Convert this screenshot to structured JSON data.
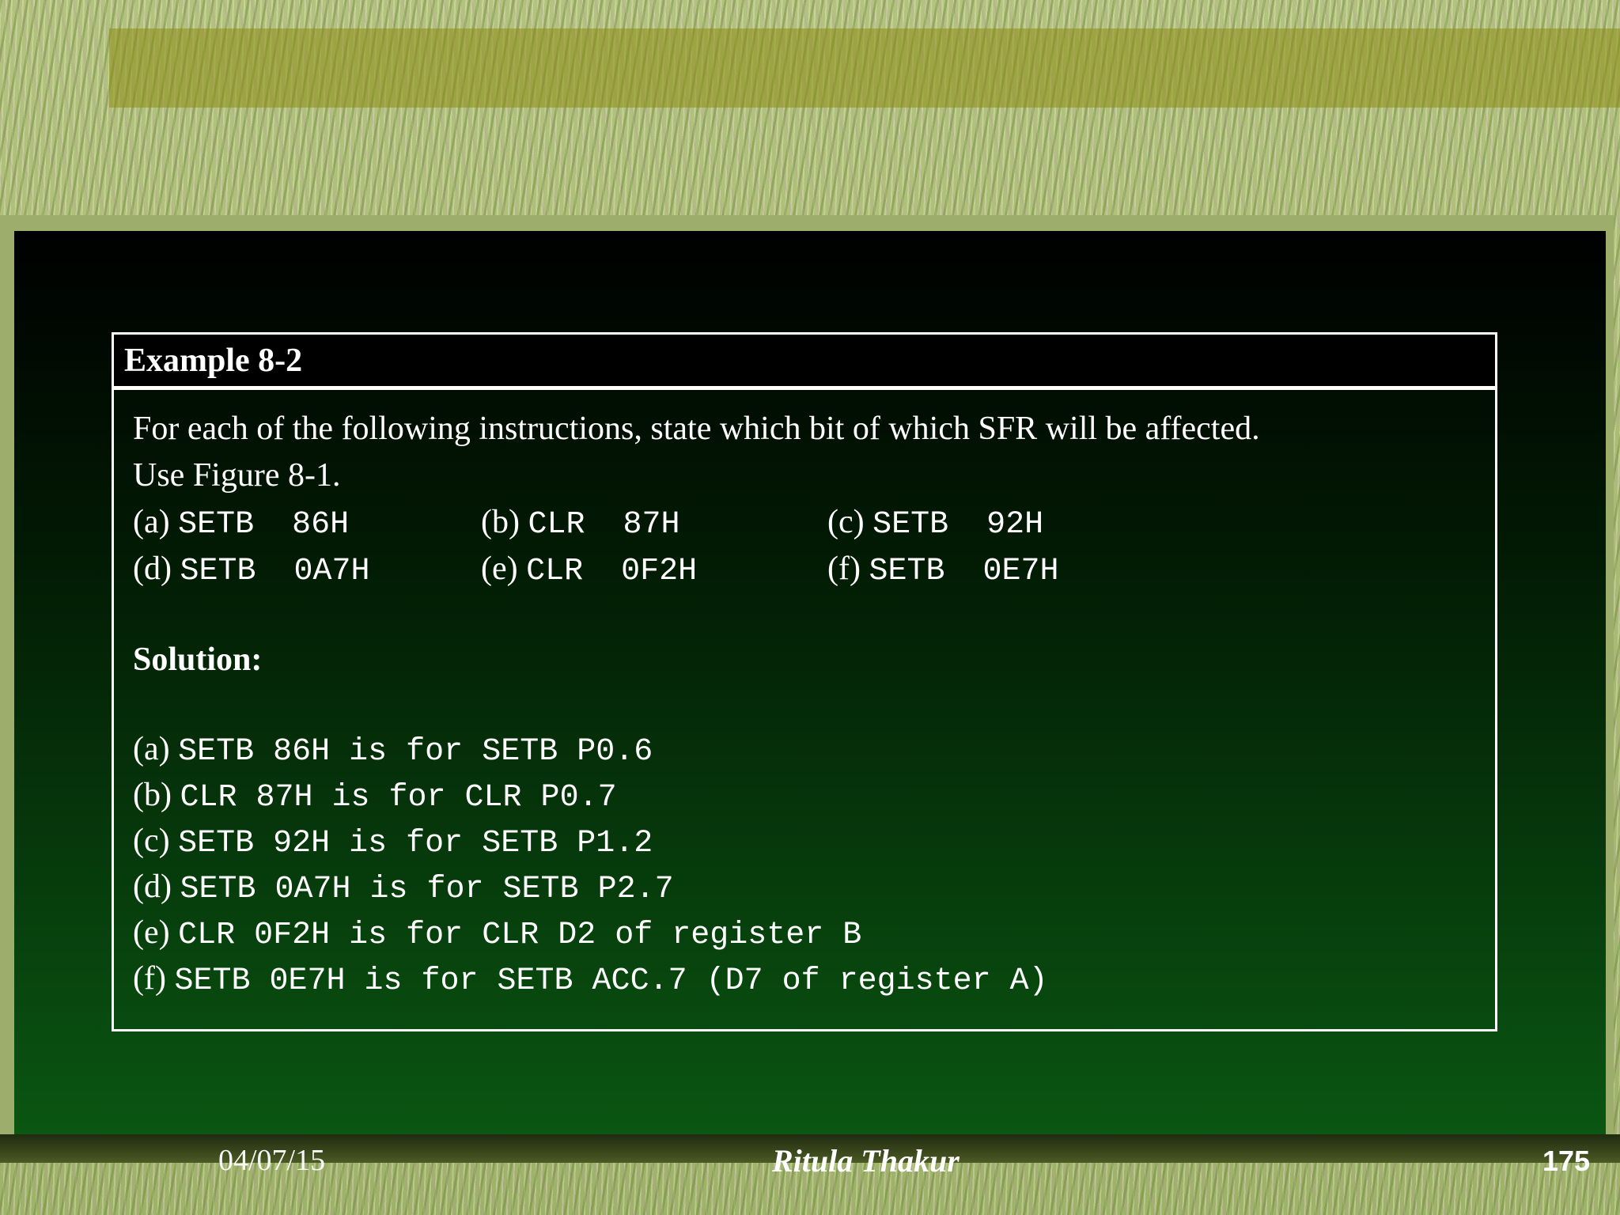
{
  "example": {
    "title": "Example 8-2",
    "problem_line1": "For each of the following instructions, state which bit of which SFR will be affected.",
    "problem_line2": "Use Figure 8-1.",
    "instructions": [
      {
        "label": "(a)",
        "code": "SETB  86H"
      },
      {
        "label": "(b)",
        "code": "CLR  87H"
      },
      {
        "label": "(c)",
        "code": "SETB  92H"
      },
      {
        "label": "(d)",
        "code": "SETB  0A7H"
      },
      {
        "label": "(e)",
        "code": "CLR  0F2H"
      },
      {
        "label": "(f)",
        "code": "SETB  0E7H"
      }
    ]
  },
  "solution": {
    "title": "Solution:",
    "answers": [
      {
        "label": "(a)",
        "text": "SETB 86H is for SETB P0.6"
      },
      {
        "label": "(b)",
        "text": "CLR 87H is for CLR P0.7"
      },
      {
        "label": "(c)",
        "text": "SETB 92H is for SETB P1.2"
      },
      {
        "label": "(d)",
        "text": "SETB 0A7H is for SETB P2.7"
      },
      {
        "label": "(e)",
        "text": "CLR 0F2H is for CLR D2 of register B"
      },
      {
        "label": "(f)",
        "text": "SETB 0E7H is for SETB ACC.7 (D7 of register A)"
      }
    ]
  },
  "footer": {
    "date": "04/07/15",
    "author": "Ritula Thakur",
    "page": "175"
  }
}
